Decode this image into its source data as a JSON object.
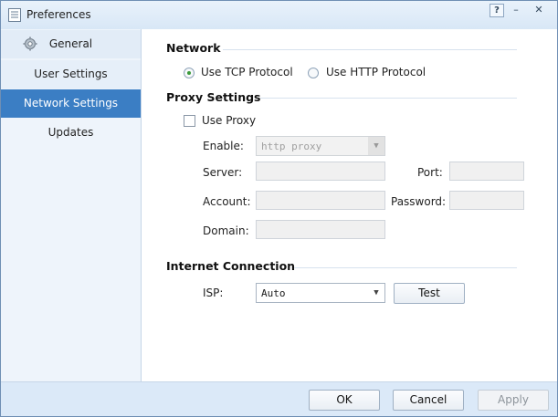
{
  "window": {
    "title": "Preferences"
  },
  "titlebar": {
    "help": "?",
    "minimize": "–",
    "close": "✕"
  },
  "sidebar": {
    "items": [
      {
        "label": "General",
        "icon": "gear-icon"
      },
      {
        "label": "User Settings"
      },
      {
        "label": "Network Settings",
        "selected": true
      },
      {
        "label": "Updates"
      }
    ]
  },
  "network": {
    "title": "Network",
    "options": [
      {
        "label": "Use TCP Protocol",
        "selected": true
      },
      {
        "label": "Use HTTP Protocol",
        "selected": false
      }
    ]
  },
  "proxy": {
    "title": "Proxy Settings",
    "use_proxy_label": "Use Proxy",
    "use_proxy_checked": false,
    "enable_label": "Enable:",
    "enable_value": "http proxy",
    "server_label": "Server:",
    "server_value": "",
    "port_label": "Port:",
    "port_value": "",
    "account_label": "Account:",
    "account_value": "",
    "password_label": "Password:",
    "password_value": "",
    "domain_label": "Domain:",
    "domain_value": ""
  },
  "internet": {
    "title": "Internet Connection",
    "isp_label": "ISP:",
    "isp_value": "Auto",
    "test_label": "Test"
  },
  "footer": {
    "ok": "OK",
    "cancel": "Cancel",
    "apply": "Apply"
  },
  "colors": {
    "selected_item_bg": "#3b7ec4",
    "radio_dot": "#3a9a3a",
    "window_bg": "#dbe9f8"
  }
}
